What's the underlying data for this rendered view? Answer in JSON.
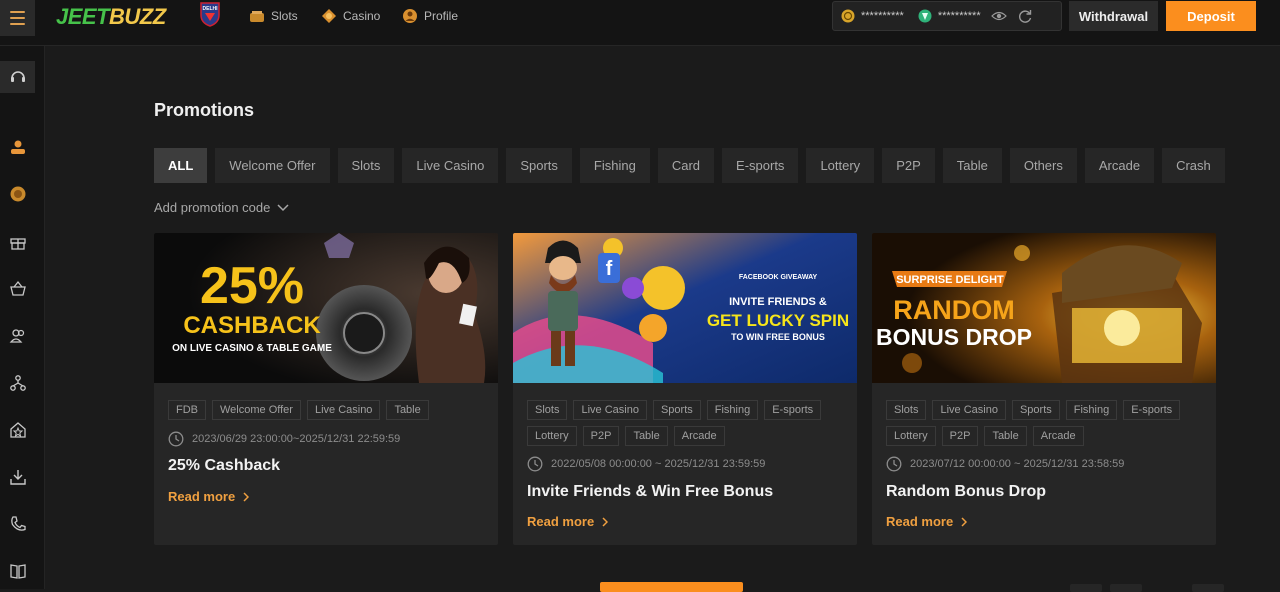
{
  "header": {
    "logo_part1": "JEET",
    "logo_part2": "BUZZ",
    "badge_text": "DELHI",
    "nav": [
      {
        "label": "Slots",
        "icon": "slots-icon"
      },
      {
        "label": "Casino",
        "icon": "casino-icon"
      },
      {
        "label": "Profile",
        "icon": "profile-icon"
      }
    ],
    "wallet": {
      "main_balance": "**********",
      "bonus_balance": "**********"
    },
    "withdraw_label": "Withdrawal",
    "deposit_label": "Deposit"
  },
  "sidebar": {
    "items": [
      "support-icon",
      "user-icon",
      "coin-icon",
      "gift-icon",
      "vip-basket-icon",
      "members-icon",
      "referral-icon",
      "home-badge-icon",
      "download-icon",
      "phone-icon",
      "book-icon"
    ]
  },
  "main": {
    "title": "Promotions",
    "tabs": [
      "ALL",
      "Welcome Offer",
      "Slots",
      "Live Casino",
      "Sports",
      "Fishing",
      "Card",
      "E-sports",
      "Lottery",
      "P2P",
      "Table",
      "Others",
      "Arcade",
      "Crash"
    ],
    "active_tab": "ALL",
    "promo_code_label": "Add promotion code"
  },
  "cards": [
    {
      "banner": {
        "big": "25%",
        "mid": "CASHBACK",
        "small": "ON LIVE CASINO & TABLE GAME"
      },
      "tags": [
        "FDB",
        "Welcome Offer",
        "Live Casino",
        "Table"
      ],
      "date": "2023/06/29 23:00:00~2025/12/31 22:59:59",
      "title": "25% Cashback",
      "read_more": "Read more"
    },
    {
      "banner": {
        "top": "FACEBOOK GIVEAWAY",
        "line1": "INVITE FRIENDS &",
        "line2": "GET LUCKY SPIN",
        "line3": "TO WIN FREE BONUS"
      },
      "tags": [
        "Slots",
        "Live Casino",
        "Sports",
        "Fishing",
        "E-sports",
        "Lottery",
        "P2P",
        "Table",
        "Arcade"
      ],
      "date": "2022/05/08 00:00:00 ~ 2025/12/31 23:59:59",
      "title": "Invite Friends & Win Free Bonus",
      "read_more": "Read more"
    },
    {
      "banner": {
        "top": "SURPRISE DELIGHT",
        "line1": "RANDOM",
        "line2": "BONUS DROP"
      },
      "tags": [
        "Slots",
        "Live Casino",
        "Sports",
        "Fishing",
        "E-sports",
        "Lottery",
        "P2P",
        "Table",
        "Arcade"
      ],
      "date": "2023/07/12 00:00:00 ~ 2025/12/31 23:58:59",
      "title": "Random Bonus Drop",
      "read_more": "Read more"
    }
  ],
  "colors": {
    "accent": "#fb8e1e",
    "readmore": "#f0a040",
    "bg": "#1b1b1b",
    "card": "#262626"
  }
}
